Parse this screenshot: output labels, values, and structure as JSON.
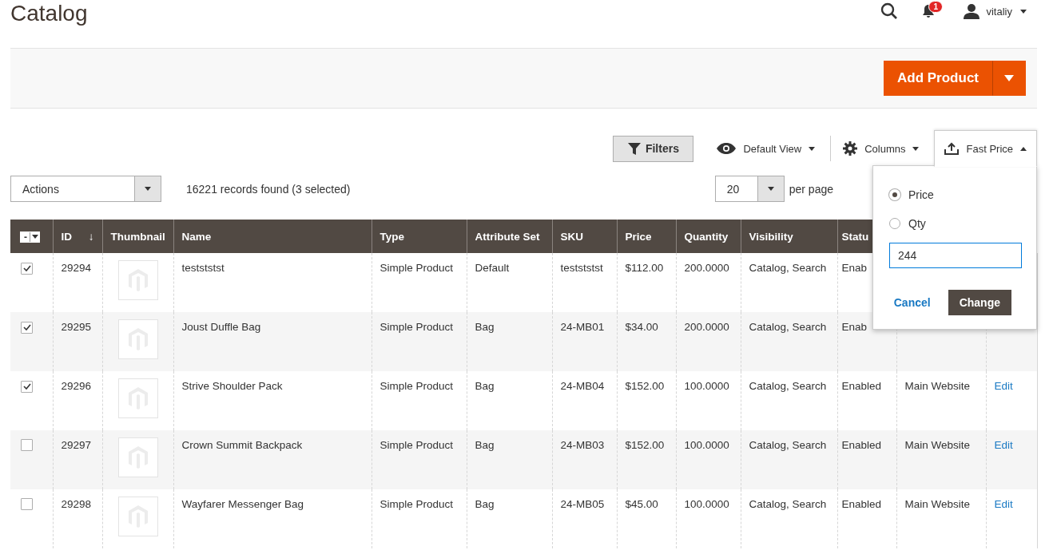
{
  "header": {
    "title": "Catalog",
    "notifications": "1",
    "user": "vitaliy"
  },
  "add_product": "Add Product",
  "toolbar": {
    "filters": "Filters",
    "view": "Default View",
    "columns": "Columns",
    "fast_price": "Fast Price",
    "fast_price_expanded": true
  },
  "actions": "Actions",
  "records": "16221 records found (3 selected)",
  "per_page": {
    "value": "20",
    "label": "per page"
  },
  "table": {
    "mass_select": "-",
    "columns": [
      {
        "label": "ID",
        "sort": "↓"
      },
      {
        "label": "Thumbnail"
      },
      {
        "label": "Name"
      },
      {
        "label": "Type"
      },
      {
        "label": "Attribute Set"
      },
      {
        "label": "SKU"
      },
      {
        "label": "Price"
      },
      {
        "label": "Quantity"
      },
      {
        "label": "Visibility"
      },
      {
        "label": "Statu"
      }
    ],
    "rows": [
      {
        "checked": true,
        "id": "29294",
        "name": "testststst",
        "type": "Simple Product",
        "attribute_set": "Default",
        "sku": "testststst",
        "price": "$112.00",
        "quantity": "200.0000",
        "visibility": "Catalog, Search",
        "status": "Enab"
      },
      {
        "checked": true,
        "id": "29295",
        "name": "Joust Duffle Bag",
        "type": "Simple Product",
        "attribute_set": "Bag",
        "sku": "24-MB01",
        "price": "$34.00",
        "quantity": "200.0000",
        "visibility": "Catalog, Search",
        "status": "Enab"
      },
      {
        "checked": true,
        "id": "29296",
        "name": "Strive Shoulder Pack",
        "type": "Simple Product",
        "attribute_set": "Bag",
        "sku": "24-MB04",
        "price": "$152.00",
        "quantity": "100.0000",
        "visibility": "Catalog, Search",
        "status": "Enabled",
        "website": "Main Website",
        "action": "Edit"
      },
      {
        "checked": false,
        "id": "29297",
        "name": "Crown Summit Backpack",
        "type": "Simple Product",
        "attribute_set": "Bag",
        "sku": "24-MB03",
        "price": "$152.00",
        "quantity": "100.0000",
        "visibility": "Catalog, Search",
        "status": "Enabled",
        "website": "Main Website",
        "action": "Edit"
      },
      {
        "checked": false,
        "id": "29298",
        "name": "Wayfarer Messenger Bag",
        "type": "Simple Product",
        "attribute_set": "Bag",
        "sku": "24-MB05",
        "price": "$45.00",
        "quantity": "100.0000",
        "visibility": "Catalog, Search",
        "status": "Enabled",
        "website": "Main Website",
        "action": "Edit"
      }
    ]
  },
  "fast_price_popup": {
    "options": [
      {
        "label": "Price",
        "selected": true
      },
      {
        "label": "Qty",
        "selected": false
      }
    ],
    "value": "244",
    "cancel": "Cancel",
    "change": "Change"
  }
}
